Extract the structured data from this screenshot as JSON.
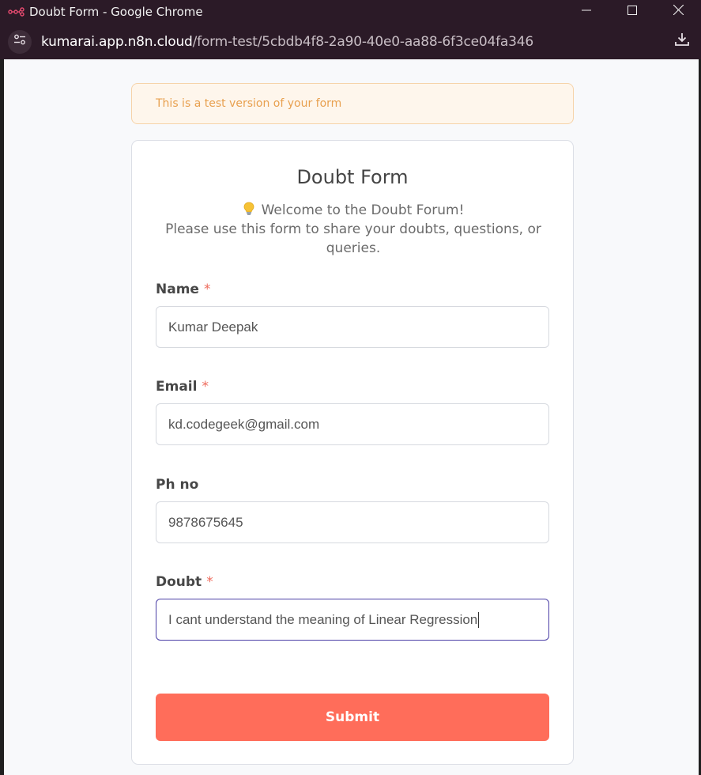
{
  "window": {
    "title": "Doubt Form - Google Chrome",
    "url_host": "kumarai.app.n8n.cloud",
    "url_path": "/form-test/5cbdb4f8-2a90-40e0-aa88-6f3ce04fa346"
  },
  "banner": {
    "text": "This is a test version of your form"
  },
  "form": {
    "title": "Doubt Form",
    "description_line1": "Welcome to the Doubt Forum!",
    "description_line2": "Please use this form to share your doubts, questions, or queries.",
    "fields": [
      {
        "label": "Name",
        "required": true,
        "value": "Kumar Deepak"
      },
      {
        "label": "Email",
        "required": true,
        "value": "kd.codegeek@gmail.com"
      },
      {
        "label": "Ph no",
        "required": false,
        "value": "9878675645"
      },
      {
        "label": "Doubt",
        "required": true,
        "value": "I cant understand the meaning of Linear Regression"
      }
    ],
    "required_marker": "*",
    "submit_label": "Submit"
  },
  "colors": {
    "accent": "#ff6d5a",
    "banner_text": "#e8a04f",
    "focus_border": "#4b3fa6"
  },
  "icons": [
    "n8n-logo-icon",
    "minimize-icon",
    "maximize-icon",
    "close-icon",
    "site-settings-icon",
    "download-icon",
    "lightbulb-icon"
  ]
}
